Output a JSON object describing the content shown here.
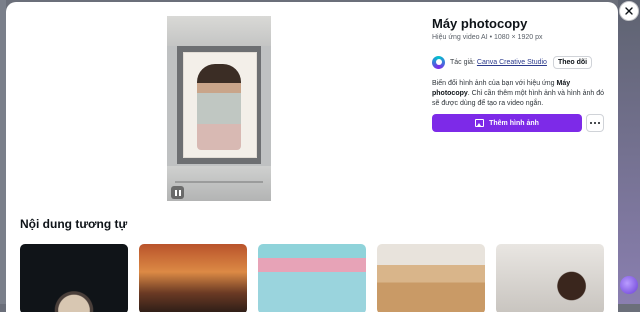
{
  "effect": {
    "title": "Máy photocopy",
    "subtitle": "Hiệu ứng video AI • 1080 × 1920 px",
    "author_prefix": "Tác giả:",
    "author_name": "Canva Creative Studio",
    "follow_label": "Theo dõi",
    "description_before": "Biến đổi hình ảnh của bạn với hiệu ứng ",
    "description_bold": "Máy photocopy",
    "description_after": ". Chỉ cần thêm một hình ảnh và hình ảnh đó sẽ được dùng để tạo ra video ngắn.",
    "use_button_label": "Thêm hình ảnh",
    "brand_color": "#7d2ae8"
  },
  "preview": {
    "pause_icon": "pause-icon"
  },
  "similar": {
    "heading": "Nội dung tương tự"
  },
  "icons": {
    "close": "close-icon",
    "more": "more-icon",
    "image": "image-icon"
  }
}
